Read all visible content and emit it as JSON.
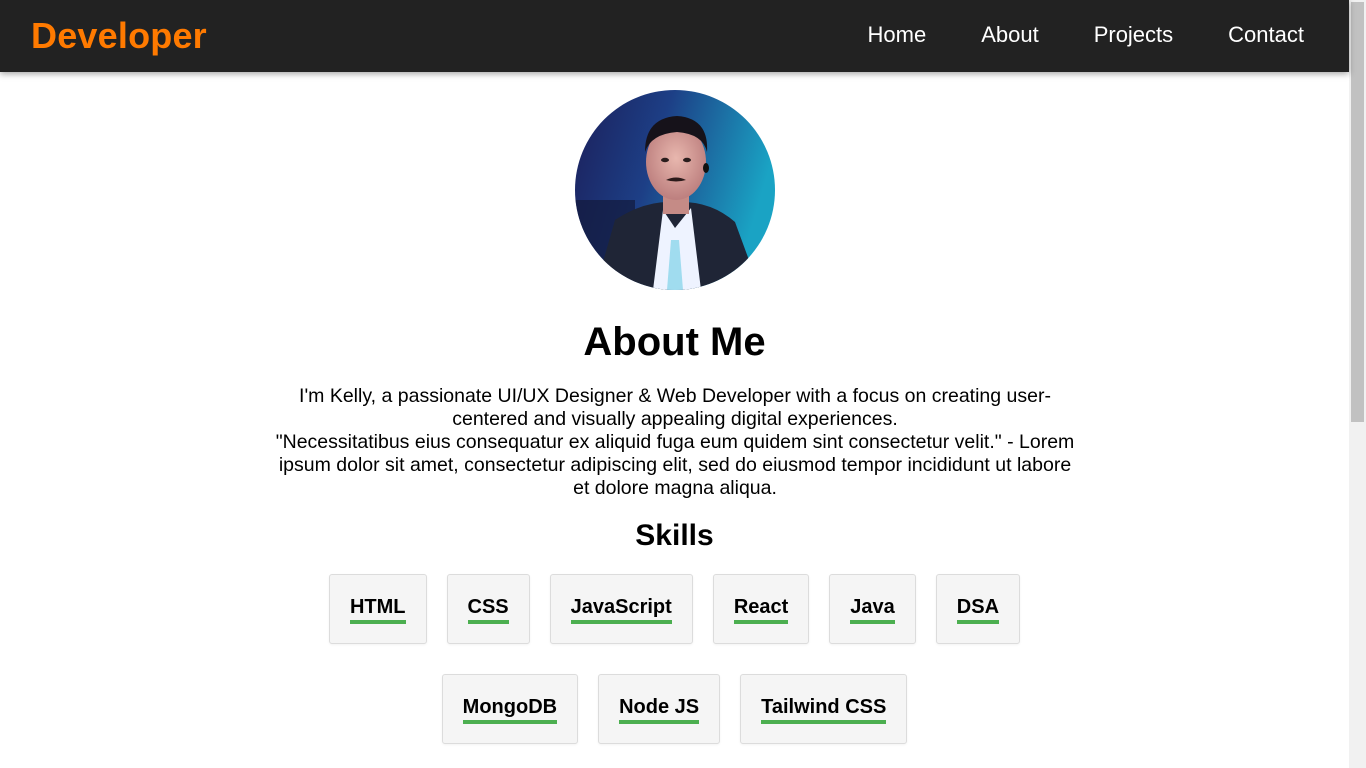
{
  "nav": {
    "brand": "Developer",
    "links": [
      "Home",
      "About",
      "Projects",
      "Contact"
    ]
  },
  "about": {
    "title": "About Me",
    "bio_line_1": "I'm Kelly, a passionate UI/UX Designer & Web Developer with a focus on creating user-centered and visually appealing digital experiences.",
    "bio_line_2": "\"Necessitatibus eius consequatur ex aliquid fuga eum quidem sint consectetur velit.\" - Lorem ipsum dolor sit amet, consectetur adipiscing elit, sed do eiusmod tempor incididunt ut labore et dolore magna aliqua."
  },
  "skills": {
    "title": "Skills",
    "row1": [
      "HTML",
      "CSS",
      "JavaScript",
      "React",
      "Java",
      "DSA"
    ],
    "row2": [
      "MongoDB",
      "Node JS",
      "Tailwind CSS"
    ]
  },
  "colors": {
    "brand": "#ff7a00",
    "navbar_bg": "#222222",
    "skill_underline": "#4caf50"
  }
}
